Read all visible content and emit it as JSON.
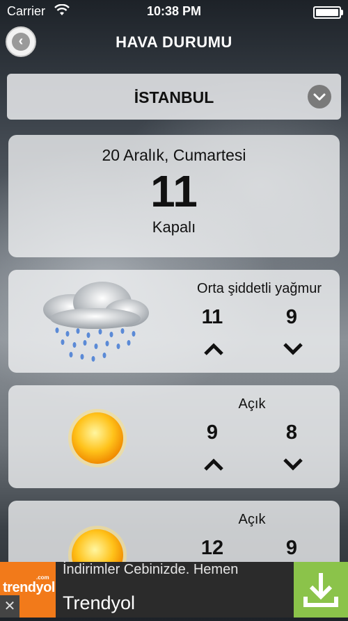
{
  "status_bar": {
    "carrier": "Carrier",
    "time": "10:38 PM"
  },
  "header": {
    "title": "HAVA DURUMU"
  },
  "city_selector": {
    "city": "İSTANBUL"
  },
  "today": {
    "date": "20 Aralık, Cumartesi",
    "temperature": "11",
    "condition": "Kapalı"
  },
  "forecast": [
    {
      "condition": "Orta şiddetli yağmur",
      "high": "11",
      "low": "9",
      "icon": "rain-cloud-icon"
    },
    {
      "condition": "Açık",
      "high": "9",
      "low": "8",
      "icon": "sun-icon"
    },
    {
      "condition": "Açık",
      "high": "12",
      "low": "9",
      "icon": "sun-icon"
    }
  ],
  "ad": {
    "logo": "trendyol",
    "logo_suffix": ".com",
    "headline": "İndirimler Cebinizde. Hemen",
    "name": "Trendyol"
  }
}
